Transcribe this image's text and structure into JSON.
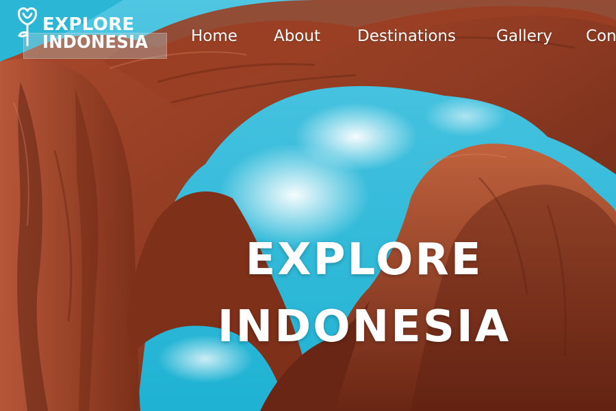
{
  "logo": {
    "line1": "EXPLORE",
    "line2": "INDONESIA",
    "icon": "rose-icon"
  },
  "nav": {
    "items": [
      {
        "label": "Home"
      },
      {
        "label": "About"
      },
      {
        "label": "Destinations"
      },
      {
        "label": "Gallery"
      },
      {
        "label": "Con"
      }
    ]
  },
  "hero": {
    "title_line1": "EXPLORE",
    "title_line2": "INDONESIA"
  },
  "colors": {
    "sky": "#2bb6d6",
    "rock_dark": "#7a2d18",
    "rock_mid": "#a8482a",
    "rock_light": "#c66a45",
    "text": "#ffffff"
  }
}
